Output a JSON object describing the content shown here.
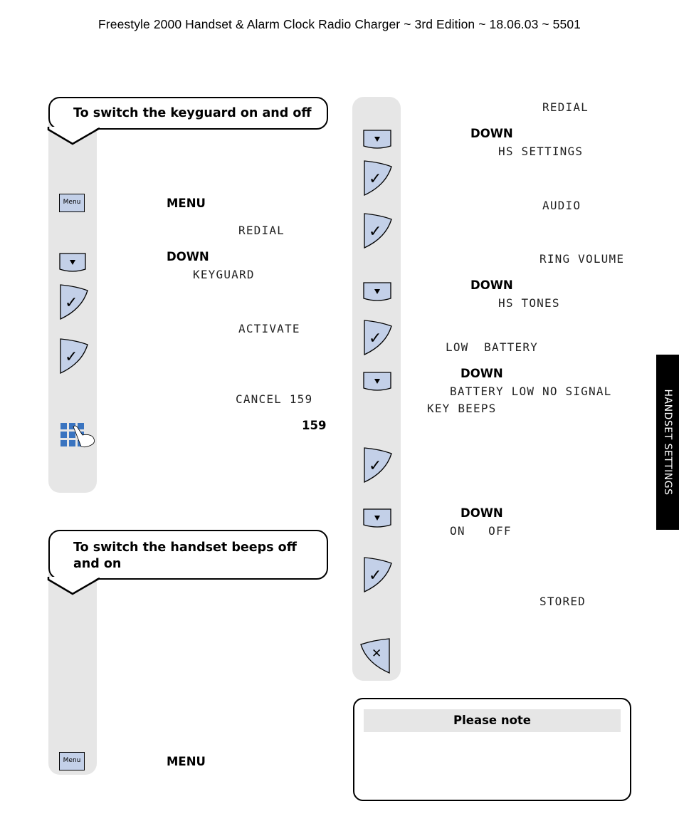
{
  "header": {
    "title": "Freestyle 2000 Handset & Alarm Clock Radio Charger  ~ 3rd Edition ~ 18.06.03 ~ 5501"
  },
  "side_tab": {
    "label": "HANDSET SETTINGS"
  },
  "colors": {
    "key_fill": "#c3d0e8",
    "strip_bg": "#e6e6e6",
    "keypad_blue": "#3a74c0",
    "side_tab_bg": "#000000"
  },
  "keyguard": {
    "title": "To switch the keyguard on and off",
    "steps": [
      {
        "icon": "menu-key",
        "key_label": "Menu",
        "command": "MENU",
        "display": "REDIAL"
      },
      {
        "icon": "down-key",
        "command": "DOWN",
        "display": "KEYGUARD"
      },
      {
        "icon": "ok-key",
        "display": "ACTIVATE"
      },
      {
        "icon": "ok-key",
        "display": "CANCEL 159"
      },
      {
        "icon": "keypad-icon",
        "command": "159"
      }
    ]
  },
  "beeps": {
    "title_line1": "To switch the handset beeps off",
    "title_line2": "and on",
    "steps": [
      {
        "icon": "menu-key",
        "key_label": "Menu",
        "command": "MENU"
      }
    ]
  },
  "right_column": {
    "steps": [
      {
        "display": "REDIAL"
      },
      {
        "icon": "down-key",
        "command": "DOWN",
        "display": "HS SETTINGS"
      },
      {
        "icon": "ok-key",
        "display": "AUDIO"
      },
      {
        "icon": "ok-key",
        "display": "RING VOLUME"
      },
      {
        "icon": "down-key",
        "command": "DOWN",
        "display": "HS TONES"
      },
      {
        "icon": "ok-key",
        "display": "LOW  BATTERY"
      },
      {
        "icon": "down-key",
        "command": "DOWN",
        "display": "BATTERY LOW NO SIGNAL",
        "display2": "KEY BEEPS"
      },
      {
        "icon": "ok-key"
      },
      {
        "icon": "down-key",
        "command": "DOWN",
        "display": "ON   OFF"
      },
      {
        "icon": "ok-key",
        "display": "STORED"
      },
      {
        "icon": "end-key"
      }
    ]
  },
  "note": {
    "title": "Please note"
  }
}
